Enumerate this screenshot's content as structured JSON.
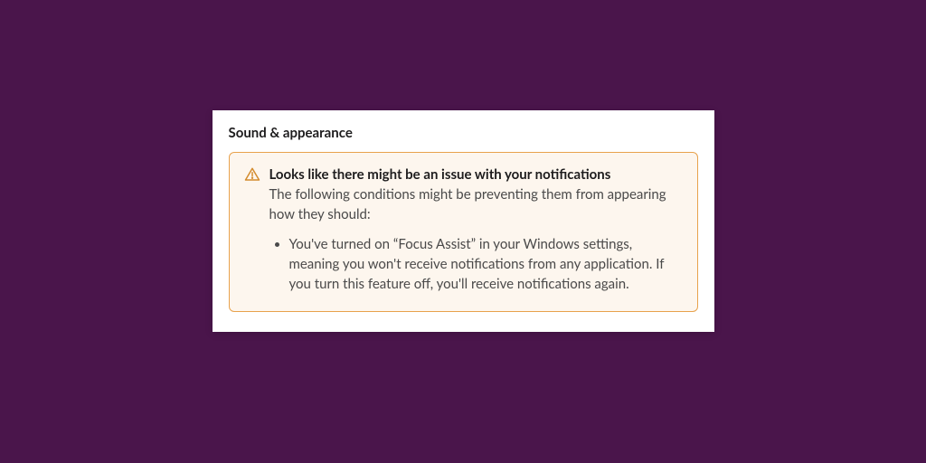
{
  "section": {
    "title": "Sound & appearance"
  },
  "alert": {
    "title": "Looks like there might be an issue with your notifications",
    "description": "The following conditions might be preventing them from appearing how they should:",
    "items": [
      "You've turned on “Focus Assist” in your Windows settings, meaning you won't receive notifications from any application. If you turn this feature off, you'll receive notifications again."
    ]
  },
  "colors": {
    "background": "#4a154b",
    "panel_bg": "#ffffff",
    "alert_bg": "#fdf6ee",
    "alert_border": "#e8a24d",
    "warning_icon": "#e8a24d"
  }
}
